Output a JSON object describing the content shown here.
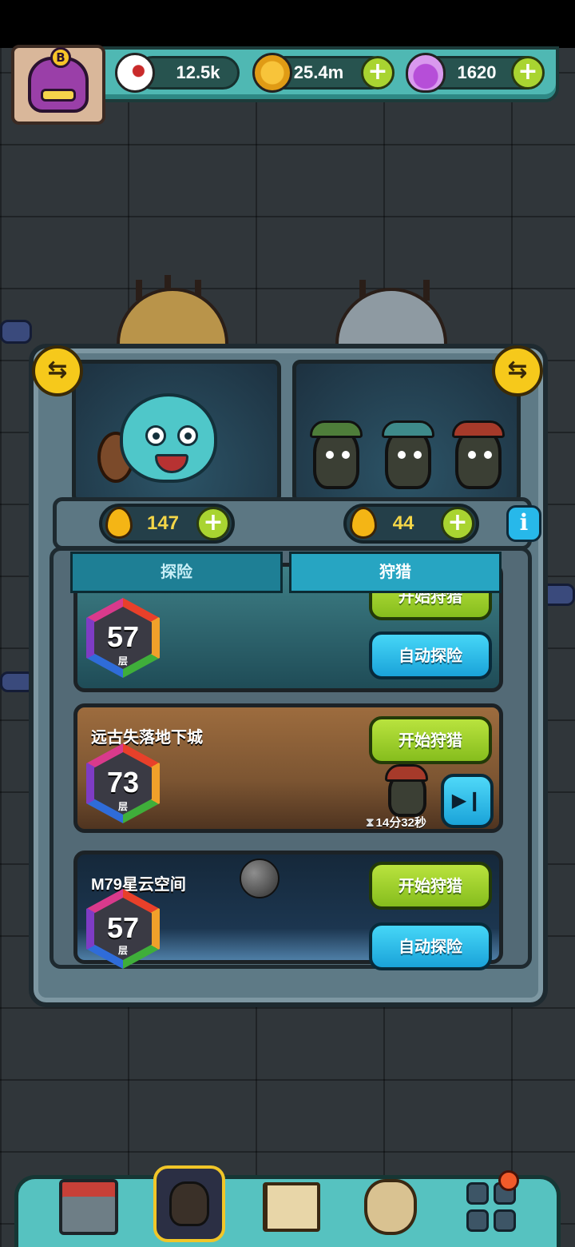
{
  "resources": {
    "eye": {
      "icon": "eyeball-icon",
      "value": "12.5k"
    },
    "coin": {
      "icon": "gold-coin-icon",
      "value": "25.4m"
    },
    "potion": {
      "icon": "purple-potion-icon",
      "value": "1620"
    }
  },
  "avatar": {
    "badge": "B"
  },
  "energy": {
    "left": {
      "icon": "drop-icon",
      "value": "147"
    },
    "right": {
      "icon": "drop-icon",
      "value": "44"
    }
  },
  "info_label": "i",
  "tabs": [
    {
      "label": "探险",
      "active": false
    },
    {
      "label": "狩猎",
      "active": true
    }
  ],
  "dungeons": [
    {
      "name": "",
      "level": "57",
      "unit": "层",
      "primary": "开始狩猎",
      "secondary": "自动探险"
    },
    {
      "name": "远古失落地下城",
      "level": "73",
      "unit": "层",
      "primary": "开始狩猎",
      "timer": "14分32秒"
    },
    {
      "name": "M79星云空间",
      "level": "57",
      "unit": "层",
      "primary": "开始狩猎",
      "secondary": "自动探险"
    }
  ],
  "skip_icon": "▶❙",
  "swap_icon": "⇆",
  "nav": [
    "shop-icon",
    "hunt-icon",
    "book-icon",
    "bag-icon",
    "menu-icon"
  ],
  "colors": {
    "accent_green": "#a9d431",
    "accent_blue": "#27b8ea",
    "frame_teal": "#4fb8b3"
  }
}
